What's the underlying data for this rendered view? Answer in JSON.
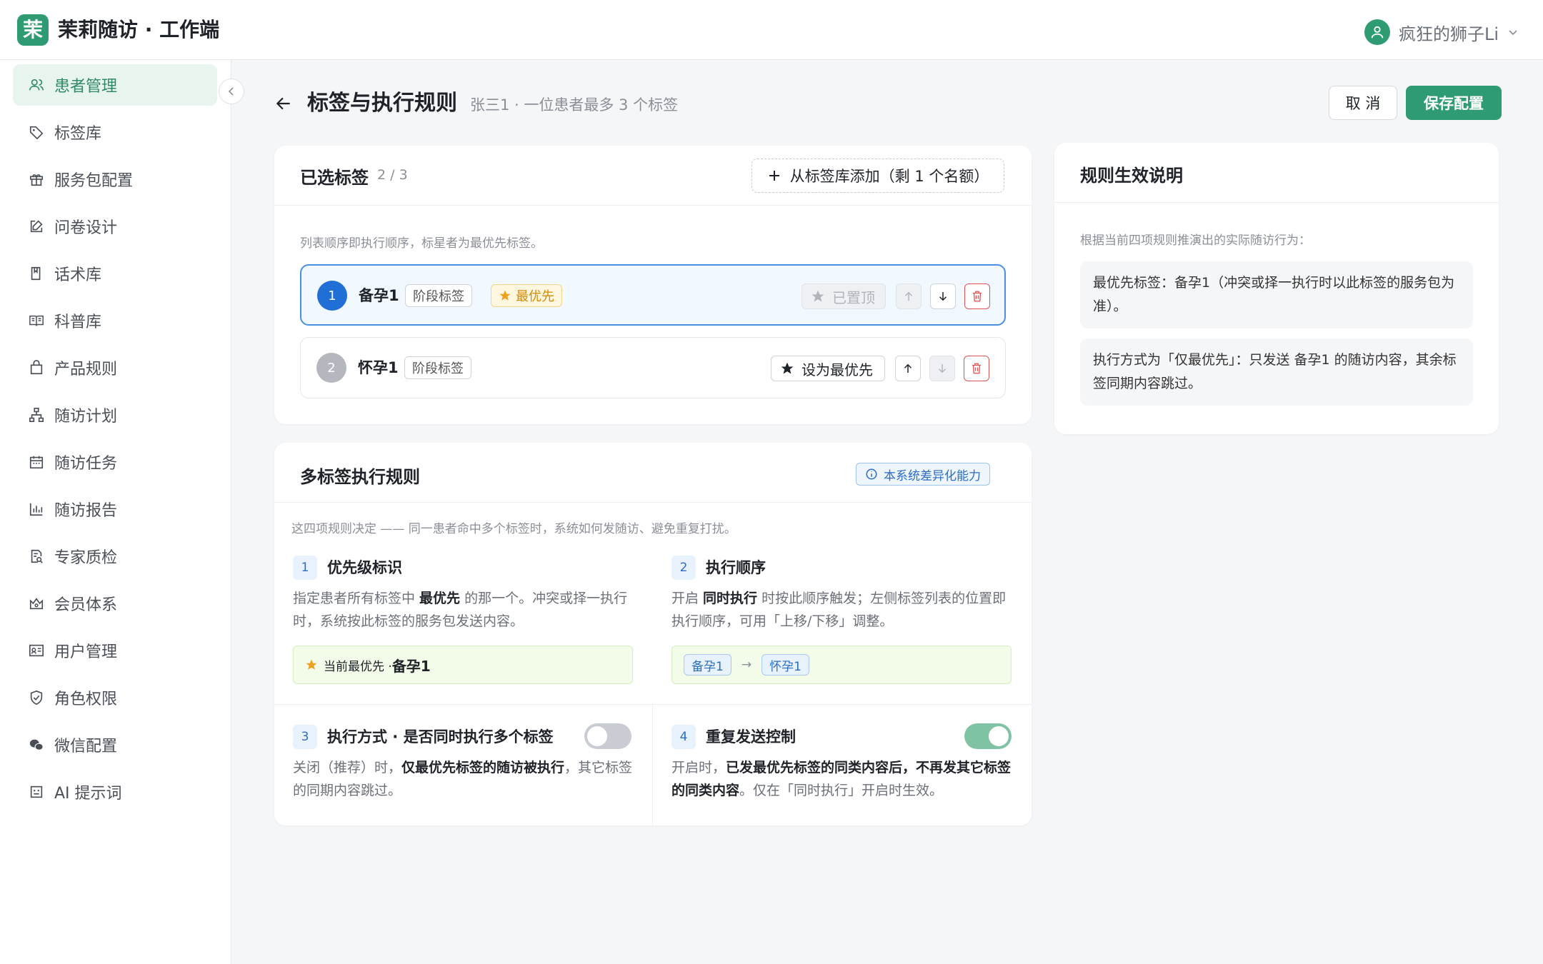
{
  "app": {
    "logo_char": "茉",
    "title": "茉莉随访 · 工作端",
    "user_name": "疯狂的狮子Li"
  },
  "sidebar": {
    "items": [
      {
        "label": "患者管理",
        "icon": "user-group-icon",
        "active": true
      },
      {
        "label": "标签库",
        "icon": "tag-icon"
      },
      {
        "label": "服务包配置",
        "icon": "gift-icon"
      },
      {
        "label": "问卷设计",
        "icon": "edit-icon"
      },
      {
        "label": "话术库",
        "icon": "book-icon"
      },
      {
        "label": "科普库",
        "icon": "open-book-icon"
      },
      {
        "label": "产品规则",
        "icon": "bag-icon"
      },
      {
        "label": "随访计划",
        "icon": "org-chart-icon"
      },
      {
        "label": "随访任务",
        "icon": "calendar-icon"
      },
      {
        "label": "随访报告",
        "icon": "bar-chart-icon"
      },
      {
        "label": "专家质检",
        "icon": "file-search-icon"
      },
      {
        "label": "会员体系",
        "icon": "crown-icon"
      },
      {
        "label": "用户管理",
        "icon": "id-card-icon"
      },
      {
        "label": "角色权限",
        "icon": "shield-icon"
      },
      {
        "label": "微信配置",
        "icon": "wechat-icon"
      },
      {
        "label": "AI 提示词",
        "icon": "robot-icon"
      }
    ]
  },
  "header": {
    "title": "标签与执行规则",
    "subtitle": "张三1 · 一位患者最多 3 个标签",
    "cancel_label": "取 消",
    "save_label": "保存配置"
  },
  "selected": {
    "title": "已选标签",
    "count": "2 / 3",
    "add_label": "从标签库添加（剩 1 个名额）",
    "hint": "列表顺序即执行顺序，标星者为最优先标签。",
    "rows": [
      {
        "index": "1",
        "name": "备孕1",
        "type": "阶段标签",
        "badge": "最优先",
        "action": "已置顶"
      },
      {
        "index": "2",
        "name": "怀孕1",
        "type": "阶段标签",
        "action": "设为最优先"
      }
    ]
  },
  "rules": {
    "title": "多标签执行规则",
    "badge": "本系统差异化能力",
    "intro": "这四项规则决定 —— 同一患者命中多个标签时，系统如何发随访、避免重复打扰。",
    "r1": {
      "num": "1",
      "title": "优先级标识",
      "desc_a": "指定患者所有标签中 ",
      "desc_b": "最优先",
      "desc_c": " 的那一个。冲突或择一执行时，系统按此标签的服务包发送内容。",
      "box_label": "当前最优先 · ",
      "box_value": "备孕1"
    },
    "r2": {
      "num": "2",
      "title": "执行顺序",
      "desc_a": "开启 ",
      "desc_b": "同时执行",
      "desc_c": " 时按此顺序触发；左侧标签列表的位置即执行顺序，可用「上移/下移」调整。",
      "flow": [
        "备孕1",
        "→",
        "怀孕1"
      ]
    },
    "r3": {
      "num": "3",
      "title": "执行方式 · 是否同时执行多个标签",
      "desc_a": "关闭（推荐）时，",
      "desc_b": "仅最优先标签的随访被执行",
      "desc_c": "，其它标签的同期内容跳过。",
      "toggle_on": false
    },
    "r4": {
      "num": "4",
      "title": "重复发送控制",
      "desc_a": "开启时，",
      "desc_b": "已发最优先标签的同类内容后，不再发其它标签的同类内容",
      "desc_c": "。仅在「同时执行」开启时生效。",
      "toggle_on": true
    }
  },
  "explain": {
    "title": "规则生效说明",
    "intro": "根据当前四项规则推演出的实际随访行为：",
    "notes": [
      "最优先标签：备孕1（冲突或择一执行时以此标签的服务包为准）。",
      "执行方式为「仅最优先」：只发送 备孕1 的随访内容，其余标签同期内容跳过。"
    ]
  },
  "colors": {
    "primary": "#2f9b73",
    "accent_blue": "#4a90e2",
    "star": "#f0a020",
    "danger": "#e05252"
  }
}
